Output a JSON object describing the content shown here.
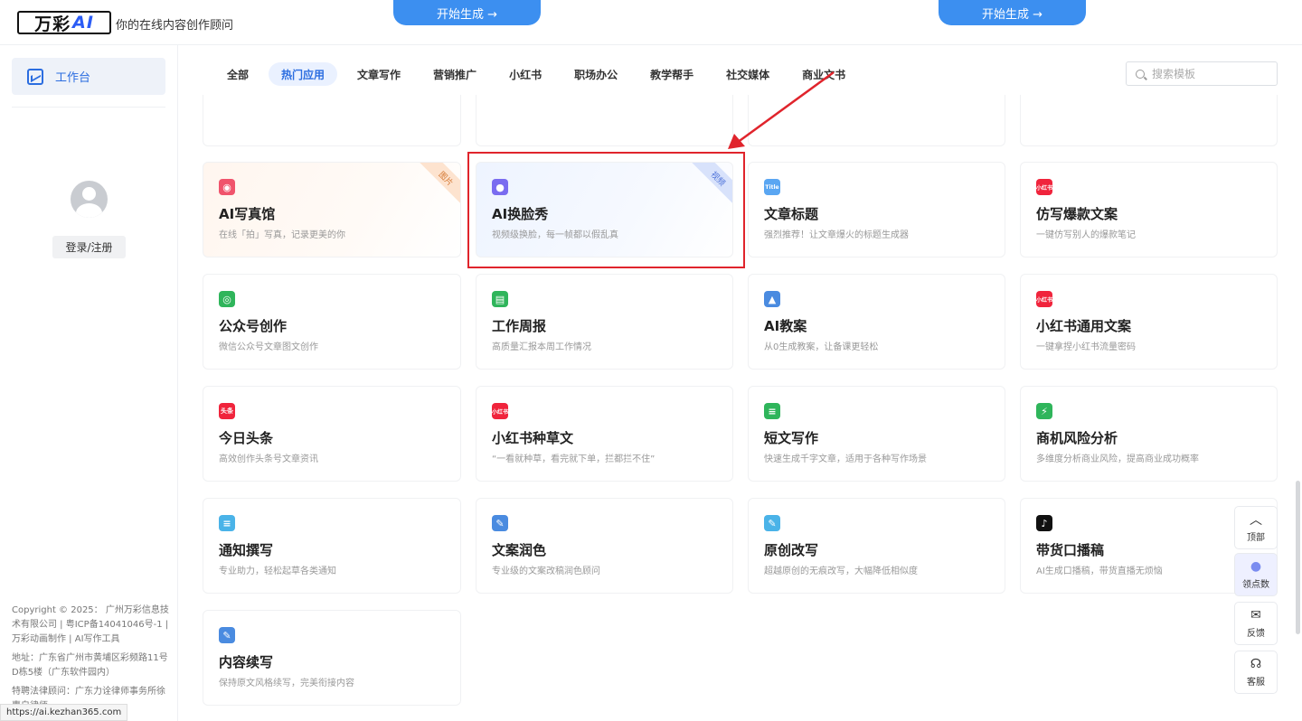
{
  "header": {
    "logo_text": "万彩",
    "logo_ai": "AI",
    "slogan": "你的在线内容创作顾问"
  },
  "sidebar": {
    "nav_label": "工作台",
    "login_label": "登录/注册",
    "footer_copyright": "Copyright © 2025： 广州万彩信息技术有限公司 | 粤ICP备14041046号-1 | 万彩动画制作 | AI写作工具",
    "footer_address": "地址：广东省广州市黄埔区彩频路11号D栋5楼（广东软件园内）",
    "footer_lawyer": "特聘法律顾问：广东力诠律师事务所徐惠自律师",
    "status_url": "https://ai.kezhan365.com"
  },
  "tabs": [
    "全部",
    "热门应用",
    "文章写作",
    "营销推广",
    "小红书",
    "职场办公",
    "教学帮手",
    "社交媒体",
    "商业文书"
  ],
  "active_tab": "热门应用",
  "search": {
    "placeholder": "搜索模板"
  },
  "banner": {
    "button_label": "开始生成 →"
  },
  "cards": [
    {
      "title": "AI写真馆",
      "desc": "在线「拍」写真，记录更美的你",
      "badge": "图片",
      "icon": "camera-icon",
      "color": "#f0546c",
      "glyph": "◉"
    },
    {
      "title": "AI换脸秀",
      "desc": "视频级换脸，每一帧都以假乱真",
      "badge": "视频",
      "icon": "face-swap-icon",
      "color": "#7a6cf0",
      "glyph": "●"
    },
    {
      "title": "文章标题",
      "desc": "强烈推荐！让文章爆火的标题生成器",
      "badge": "",
      "icon": "title-icon",
      "color": "#5aa6f2",
      "glyph": "Title"
    },
    {
      "title": "仿写爆款文案",
      "desc": "一键仿写别人的爆款笔记",
      "badge": "",
      "icon": "xiaohongshu-icon",
      "color": "#f0243c",
      "glyph": "小红书"
    },
    {
      "title": "公众号创作",
      "desc": "微信公众号文章图文创作",
      "badge": "",
      "icon": "wechat-official-icon",
      "color": "#2fb55b",
      "glyph": "◎"
    },
    {
      "title": "工作周报",
      "desc": "高质量汇报本周工作情况",
      "badge": "",
      "icon": "weekly-report-icon",
      "color": "#2fb55b",
      "glyph": "▤"
    },
    {
      "title": "AI教案",
      "desc": "从0生成教案，让备课更轻松",
      "badge": "",
      "icon": "graduation-cap-icon",
      "color": "#4a8be0",
      "glyph": "▲"
    },
    {
      "title": "小红书通用文案",
      "desc": "一键拿捏小红书流量密码",
      "badge": "",
      "icon": "xiaohongshu-icon",
      "color": "#f0243c",
      "glyph": "小红书"
    },
    {
      "title": "今日头条",
      "desc": "高效创作头条号文章资讯",
      "badge": "",
      "icon": "toutiao-icon",
      "color": "#f0243c",
      "glyph": "头条"
    },
    {
      "title": "小红书种草文",
      "desc": "“一看就种草，看完就下单，拦都拦不住”",
      "badge": "",
      "icon": "xiaohongshu-icon",
      "color": "#f0243c",
      "glyph": "小红书"
    },
    {
      "title": "短文写作",
      "desc": "快速生成千字文章，适用于各种写作场景",
      "badge": "",
      "icon": "short-text-icon",
      "color": "#2fb55b",
      "glyph": "≡"
    },
    {
      "title": "商机风险分析",
      "desc": "多维度分析商业风险，提高商业成功概率",
      "badge": "",
      "icon": "shield-icon",
      "color": "#2fb55b",
      "glyph": "⚡"
    },
    {
      "title": "通知撰写",
      "desc": "专业助力，轻松起草各类通知",
      "badge": "",
      "icon": "notice-icon",
      "color": "#4ab3e8",
      "glyph": "≡"
    },
    {
      "title": "文案润色",
      "desc": "专业级的文案改稿润色顾问",
      "badge": "",
      "icon": "polish-icon",
      "color": "#4a8be0",
      "glyph": "✎"
    },
    {
      "title": "原创改写",
      "desc": "超越原创的无痕改写，大幅降低相似度",
      "badge": "",
      "icon": "rewrite-icon",
      "color": "#4ab3e8",
      "glyph": "✎"
    },
    {
      "title": "带货口播稿",
      "desc": "AI生成口播稿，带货直播无烦恼",
      "badge": "",
      "icon": "tiktok-icon",
      "color": "#111111",
      "glyph": "♪"
    },
    {
      "title": "内容续写",
      "desc": "保持原文风格续写，完美衔接内容",
      "badge": "",
      "icon": "continue-write-icon",
      "color": "#4a8be0",
      "glyph": "✎"
    }
  ],
  "float_buttons": [
    {
      "label": "顶部",
      "icon": "arrow-up-icon",
      "glyph": "︿"
    },
    {
      "label": "领点数",
      "icon": "reward-icon",
      "glyph": "●"
    },
    {
      "label": "反馈",
      "icon": "mail-icon",
      "glyph": "✉"
    },
    {
      "label": "客服",
      "icon": "headset-icon",
      "glyph": "☊"
    }
  ]
}
